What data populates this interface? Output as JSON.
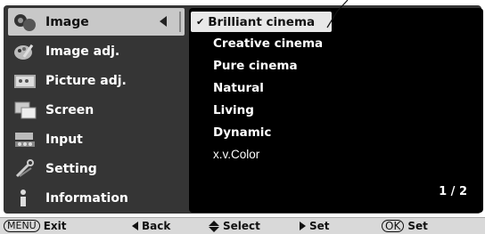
{
  "menu": {
    "items": [
      {
        "label": "Image",
        "icon": "image-icon"
      },
      {
        "label": "Image adj.",
        "icon": "palette-icon"
      },
      {
        "label": "Picture adj.",
        "icon": "picture-adj-icon"
      },
      {
        "label": "Screen",
        "icon": "screen-icon"
      },
      {
        "label": "Input",
        "icon": "input-icon"
      },
      {
        "label": "Setting",
        "icon": "wrench-icon"
      },
      {
        "label": "Information",
        "icon": "info-icon"
      }
    ]
  },
  "submenu": {
    "options": [
      {
        "label": "Brilliant cinema"
      },
      {
        "label": "Creative cinema"
      },
      {
        "label": "Pure cinema"
      },
      {
        "label": "Natural"
      },
      {
        "label": "Living"
      },
      {
        "label": "Dynamic"
      },
      {
        "label": "x.v.Color"
      }
    ],
    "check_mark": "✔",
    "page": "1 / 2"
  },
  "footer": {
    "menu_key": "MENU",
    "exit_label": "Exit",
    "back_label": "Back",
    "select_label": "Select",
    "set_label": "Set",
    "ok_key": "OK",
    "ok_set_label": "Set"
  },
  "colors": {
    "panel": "#353535",
    "submenu_bg": "#000000",
    "highlight": "#c8c8c8",
    "footer_bg": "#d9d9d9"
  }
}
